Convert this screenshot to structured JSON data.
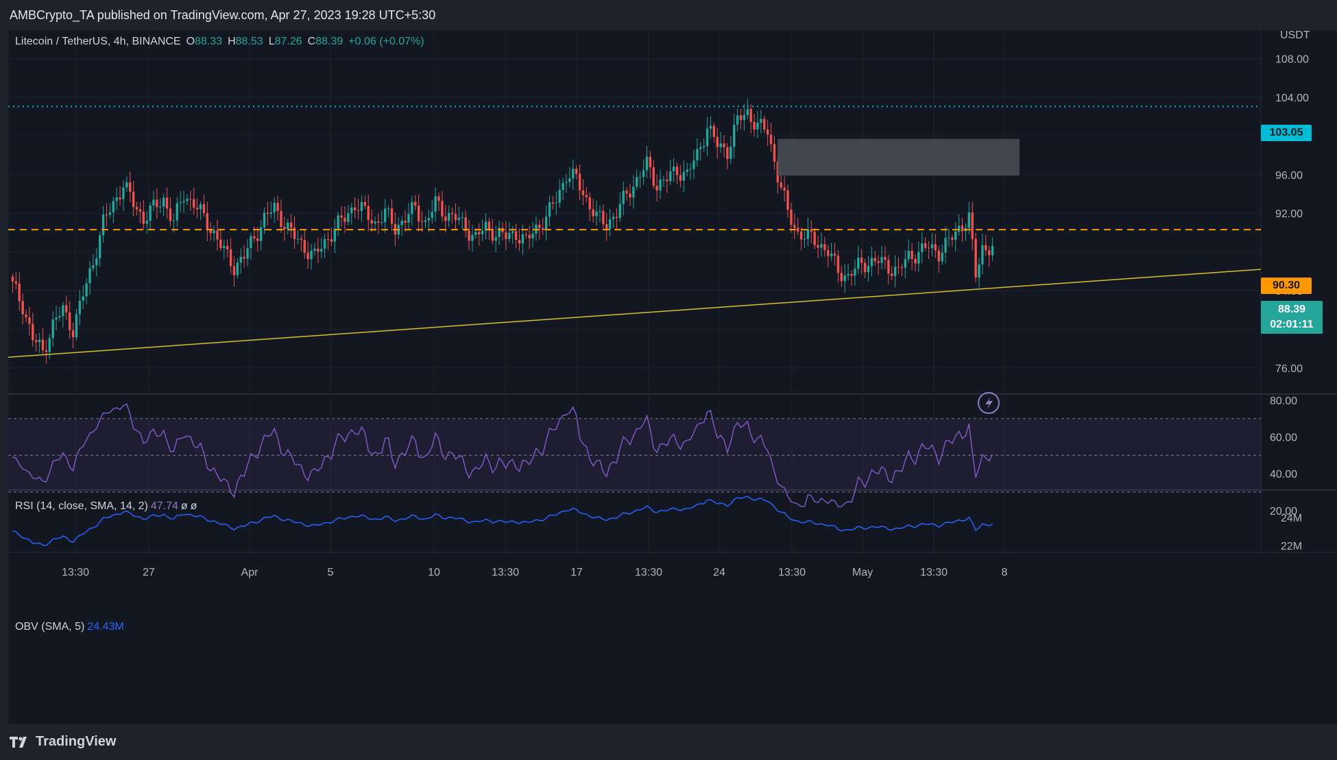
{
  "header": {
    "published_text": "AMBCrypto_TA published on TradingView.com, Apr 27, 2023 19:28 UTC+5:30"
  },
  "legend": {
    "symbol": "Litecoin / TetherUS, 4h, BINANCE",
    "o_label": "O",
    "o_value": "88.33",
    "h_label": "H",
    "h_value": "88.53",
    "l_label": "L",
    "l_value": "87.26",
    "c_label": "C",
    "c_value": "88.39",
    "change": "+0.06 (+0.07%)"
  },
  "rsi_legend": {
    "label": "RSI (14, close, SMA, 14, 2)",
    "value": "47.74",
    "extra1": "ø",
    "extra2": "ø"
  },
  "obv_legend": {
    "label": "OBV (SMA, 5)",
    "value": "24.43M"
  },
  "price_axis": {
    "currency": "USDT",
    "ticks": [
      "108.00",
      "104.00",
      "100.00",
      "96.00",
      "92.00",
      "84.00",
      "80.00",
      "76.00"
    ]
  },
  "price_tags": {
    "resistance": "103.05",
    "support": "90.30",
    "last_price": "88.39",
    "countdown": "02:01:11"
  },
  "rsi_axis": {
    "ticks": [
      "80.00",
      "60.00",
      "40.00",
      "20.00"
    ]
  },
  "obv_axis": {
    "ticks": [
      "24M",
      "22M"
    ]
  },
  "time_axis": {
    "labels": [
      "13:30",
      "27",
      "Apr",
      "5",
      "10",
      "13:30",
      "17",
      "13:30",
      "24",
      "13:30",
      "May",
      "13:30",
      "8"
    ]
  },
  "footer": {
    "brand": "TradingView"
  },
  "colors": {
    "up": "#26a69a",
    "down": "#ef5350",
    "background": "#131722",
    "resistance": "#00bcd4",
    "support": "#ff9800",
    "trendline": "#d4c32b",
    "rsi": "#7e57c2",
    "obv": "#2962ff",
    "zone": "#4a4d55"
  },
  "chart_data": [
    {
      "type": "candlestick",
      "title": "Litecoin / TetherUS, 4h, BINANCE",
      "ylabel": "USDT",
      "ylim": [
        74,
        110
      ],
      "x_start": "Mar 22",
      "x_end": "Apr 27",
      "key_levels": {
        "resistance": 103.05,
        "support": 90.3,
        "last": 88.39
      },
      "supply_zone": {
        "top": 99.7,
        "bottom": 95.9,
        "from": "Apr 19",
        "to": "Apr 26"
      },
      "trendline": {
        "start": 77.1,
        "end_at_right_edge": 86.2
      },
      "closes_waypoints": [
        [
          0,
          84.5
        ],
        [
          3,
          82.5
        ],
        [
          6,
          79.0
        ],
        [
          9,
          77.7
        ],
        [
          12,
          80.5
        ],
        [
          15,
          82.0
        ],
        [
          18,
          80.0
        ],
        [
          21,
          83.5
        ],
        [
          24,
          87.0
        ],
        [
          27,
          91.0
        ],
        [
          30,
          93.0
        ],
        [
          33,
          95.0
        ],
        [
          36,
          93.0
        ],
        [
          39,
          91.5
        ],
        [
          42,
          92.5
        ],
        [
          45,
          93.5
        ],
        [
          48,
          91.0
        ],
        [
          51,
          94.0
        ],
        [
          54,
          93.0
        ],
        [
          57,
          91.5
        ],
        [
          60,
          90.0
        ],
        [
          63,
          88.0
        ],
        [
          66,
          86.5
        ],
        [
          69,
          87.5
        ],
        [
          72,
          89.5
        ],
        [
          75,
          91.5
        ],
        [
          78,
          92.5
        ],
        [
          81,
          91.0
        ],
        [
          84,
          89.5
        ],
        [
          87,
          88.5
        ],
        [
          90,
          87.5
        ],
        [
          93,
          89.0
        ],
        [
          96,
          90.5
        ],
        [
          99,
          91.5
        ],
        [
          102,
          93.0
        ],
        [
          105,
          92.0
        ],
        [
          108,
          91.0
        ],
        [
          111,
          92.0
        ],
        [
          114,
          90.5
        ],
        [
          117,
          91.5
        ],
        [
          120,
          92.5
        ],
        [
          123,
          91.0
        ],
        [
          126,
          93.0
        ],
        [
          129,
          92.0
        ],
        [
          132,
          91.5
        ],
        [
          135,
          90.5
        ],
        [
          138,
          89.5
        ],
        [
          141,
          90.5
        ],
        [
          144,
          90.0
        ],
        [
          147,
          89.5
        ],
        [
          150,
          90.0
        ],
        [
          153,
          89.0
        ],
        [
          156,
          90.5
        ],
        [
          159,
          91.5
        ],
        [
          162,
          93.5
        ],
        [
          165,
          96.0
        ],
        [
          168,
          95.5
        ],
        [
          171,
          93.5
        ],
        [
          174,
          91.5
        ],
        [
          177,
          91.0
        ],
        [
          180,
          92.0
        ],
        [
          183,
          94.0
        ],
        [
          186,
          95.5
        ],
        [
          189,
          97.0
        ],
        [
          192,
          95.0
        ],
        [
          195,
          95.5
        ],
        [
          198,
          96.5
        ],
        [
          201,
          96.0
        ],
        [
          204,
          98.0
        ],
        [
          207,
          101.0
        ],
        [
          210,
          99.0
        ],
        [
          213,
          98.5
        ],
        [
          216,
          101.5
        ],
        [
          219,
          102.5
        ],
        [
          222,
          101.0
        ],
        [
          225,
          100.5
        ],
        [
          228,
          96.0
        ],
        [
          231,
          92.0
        ],
        [
          234,
          90.0
        ],
        [
          237,
          89.5
        ],
        [
          240,
          89.0
        ],
        [
          243,
          88.0
        ],
        [
          246,
          86.0
        ],
        [
          249,
          85.5
        ],
        [
          252,
          86.5
        ],
        [
          255,
          87.0
        ],
        [
          258,
          87.0
        ],
        [
          261,
          86.5
        ],
        [
          264,
          86.0
        ],
        [
          267,
          87.5
        ],
        [
          270,
          88.0
        ],
        [
          273,
          88.5
        ],
        [
          276,
          88.0
        ],
        [
          279,
          89.0
        ],
        [
          282,
          90.5
        ],
        [
          285,
          91.5
        ],
        [
          287,
          85.5
        ],
        [
          289,
          88.5
        ],
        [
          292,
          88.4
        ]
      ]
    },
    {
      "type": "line",
      "title": "RSI (14, close, SMA, 14, 2)",
      "ylim": [
        20,
        80
      ],
      "bands": [
        30,
        50,
        70
      ],
      "last": 47.74
    },
    {
      "type": "line",
      "title": "OBV (SMA, 5)",
      "last": "24.43M",
      "y_ticks": [
        "24M",
        "22M"
      ]
    }
  ]
}
